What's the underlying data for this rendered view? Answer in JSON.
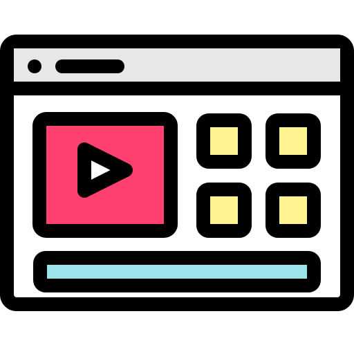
{
  "icon": {
    "name": "video-website-icon",
    "colors": {
      "outline": "#000000",
      "titlebar": "#E6E7E8",
      "page": "#FFFFFF",
      "video_panel": "#FF4170",
      "play_glyph": "#FFFFFF",
      "thumbnail": "#FFF48F",
      "progress_bar": "#9CE3ED"
    }
  }
}
